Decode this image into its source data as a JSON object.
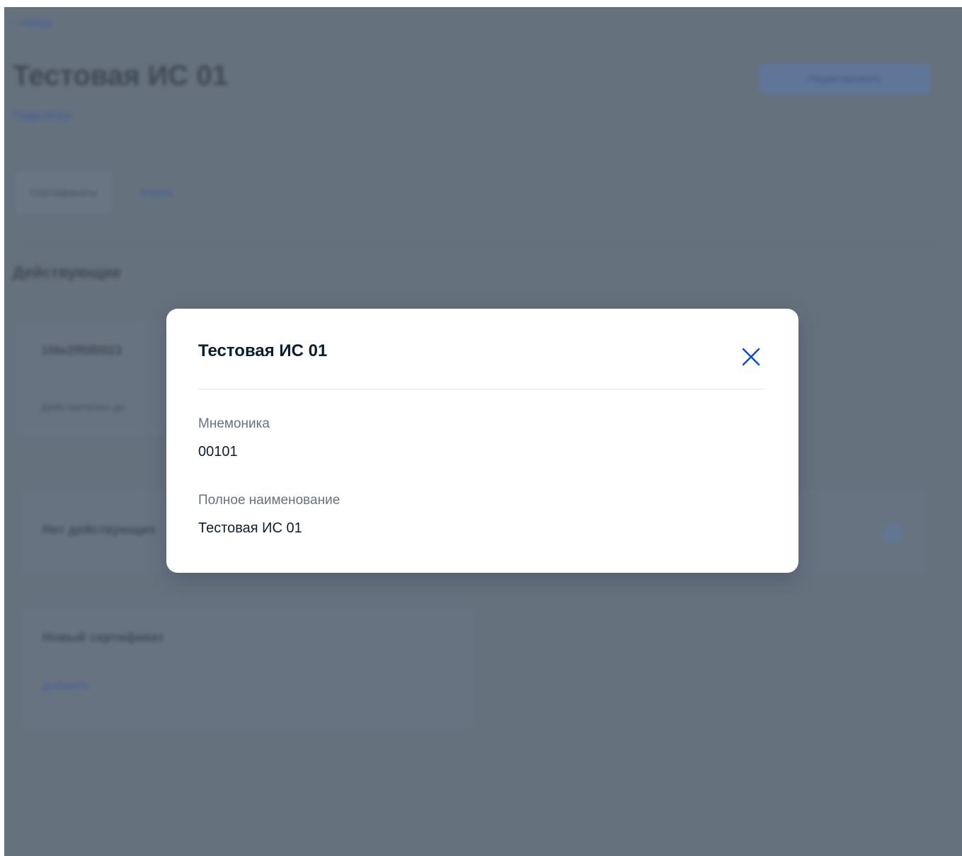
{
  "background_page": {
    "back_link": "‹ Назад",
    "title": "Тестовая ИС 01",
    "subtitle_link": "Подробнее",
    "edit_button_label": "Редактировать",
    "tabs": [
      {
        "label": "Сертификаты"
      },
      {
        "label": "Ключи"
      }
    ],
    "section_title": "Действующие",
    "certificate_card": {
      "id_text": "1f4e2ff0f0023",
      "meta_text": "Действителен до"
    },
    "search_card_text": "Нет действующих",
    "new_certificate_card": {
      "title": "Новый сертификат",
      "action_link": "Добавить"
    }
  },
  "modal": {
    "title": "Тестовая ИС 01",
    "close_icon": "close-icon",
    "fields": [
      {
        "label": "Мнемоника",
        "value": "00101"
      },
      {
        "label": "Полное наименование",
        "value": "Тестовая ИС 01"
      }
    ]
  },
  "colors": {
    "overlay": "#66717e",
    "accent": "#0d4cd3",
    "modal_background": "#ffffff",
    "title_text": "#0b1f33",
    "label_text": "#66727f"
  }
}
